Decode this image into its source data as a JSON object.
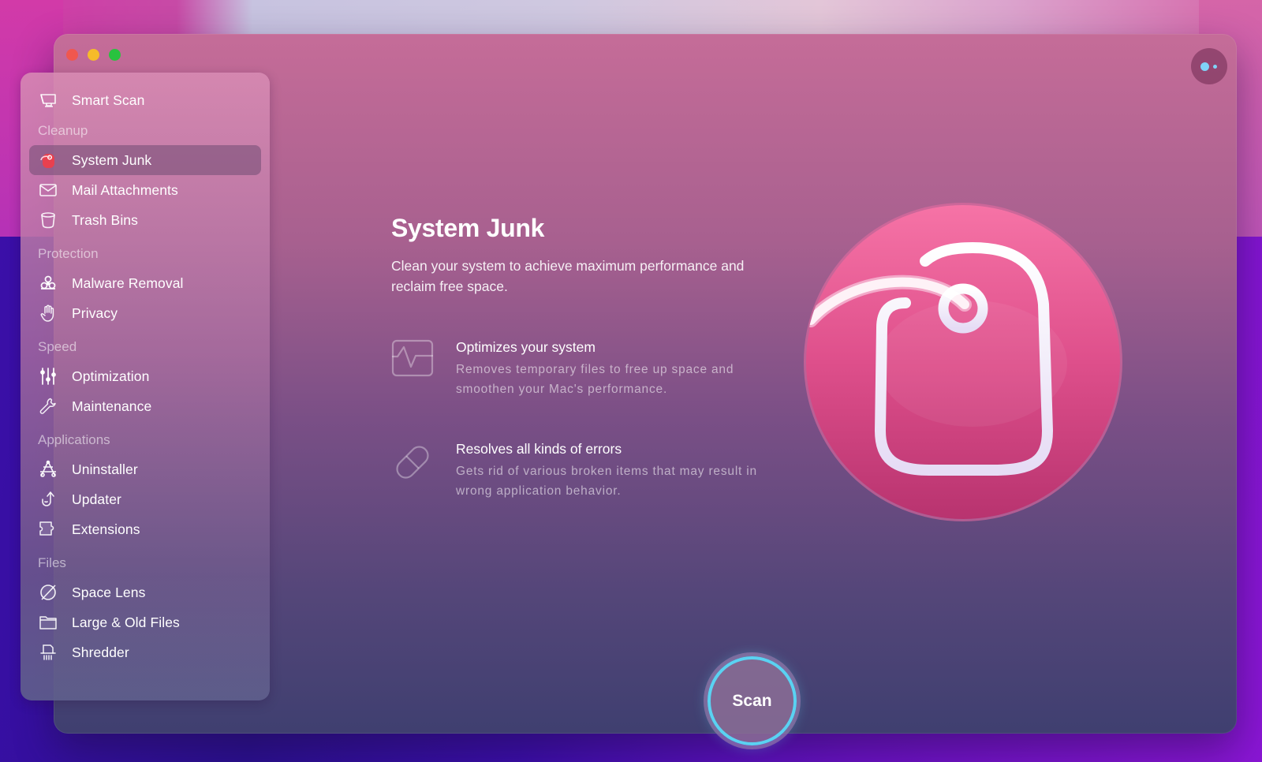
{
  "window": {
    "traffic_lights": [
      "close",
      "minimize",
      "maximize"
    ],
    "assistant_icon": "assistant-dots-icon"
  },
  "sidebar": {
    "top_item": {
      "label": "Smart Scan",
      "icon": "monitor-icon"
    },
    "sections": [
      {
        "title": "Cleanup",
        "items": [
          {
            "label": "System Junk",
            "icon": "tag-icon",
            "active": true
          },
          {
            "label": "Mail Attachments",
            "icon": "envelope-icon"
          },
          {
            "label": "Trash Bins",
            "icon": "trash-bin-icon"
          }
        ]
      },
      {
        "title": "Protection",
        "items": [
          {
            "label": "Malware Removal",
            "icon": "biohazard-icon"
          },
          {
            "label": "Privacy",
            "icon": "hand-icon"
          }
        ]
      },
      {
        "title": "Speed",
        "items": [
          {
            "label": "Optimization",
            "icon": "sliders-icon"
          },
          {
            "label": "Maintenance",
            "icon": "wrench-icon"
          }
        ]
      },
      {
        "title": "Applications",
        "items": [
          {
            "label": "Uninstaller",
            "icon": "app-store-icon"
          },
          {
            "label": "Updater",
            "icon": "update-arrow-icon"
          },
          {
            "label": "Extensions",
            "icon": "puzzle-icon"
          }
        ]
      },
      {
        "title": "Files",
        "items": [
          {
            "label": "Space Lens",
            "icon": "planet-icon"
          },
          {
            "label": "Large & Old Files",
            "icon": "folder-icon"
          },
          {
            "label": "Shredder",
            "icon": "shredder-icon"
          }
        ]
      }
    ]
  },
  "main": {
    "title": "System Junk",
    "subtitle": "Clean your system to achieve maximum performance and reclaim free space.",
    "features": [
      {
        "icon": "pulse-monitor-icon",
        "title": "Optimizes your system",
        "description": "Removes temporary files to free up space and smoothen your Mac's performance."
      },
      {
        "icon": "pill-icon",
        "title": "Resolves all kinds of errors",
        "description": "Gets rid of various broken items that may result in wrong application behavior."
      }
    ],
    "hero_icon": "system-junk-tag-icon",
    "scan_button": "Scan"
  },
  "colors": {
    "accent_ring": "#5ad2f2",
    "hero_pink": "#e9558f",
    "close": "#f0574f",
    "minimize": "#f6bb2a",
    "maximize": "#29c23f"
  }
}
